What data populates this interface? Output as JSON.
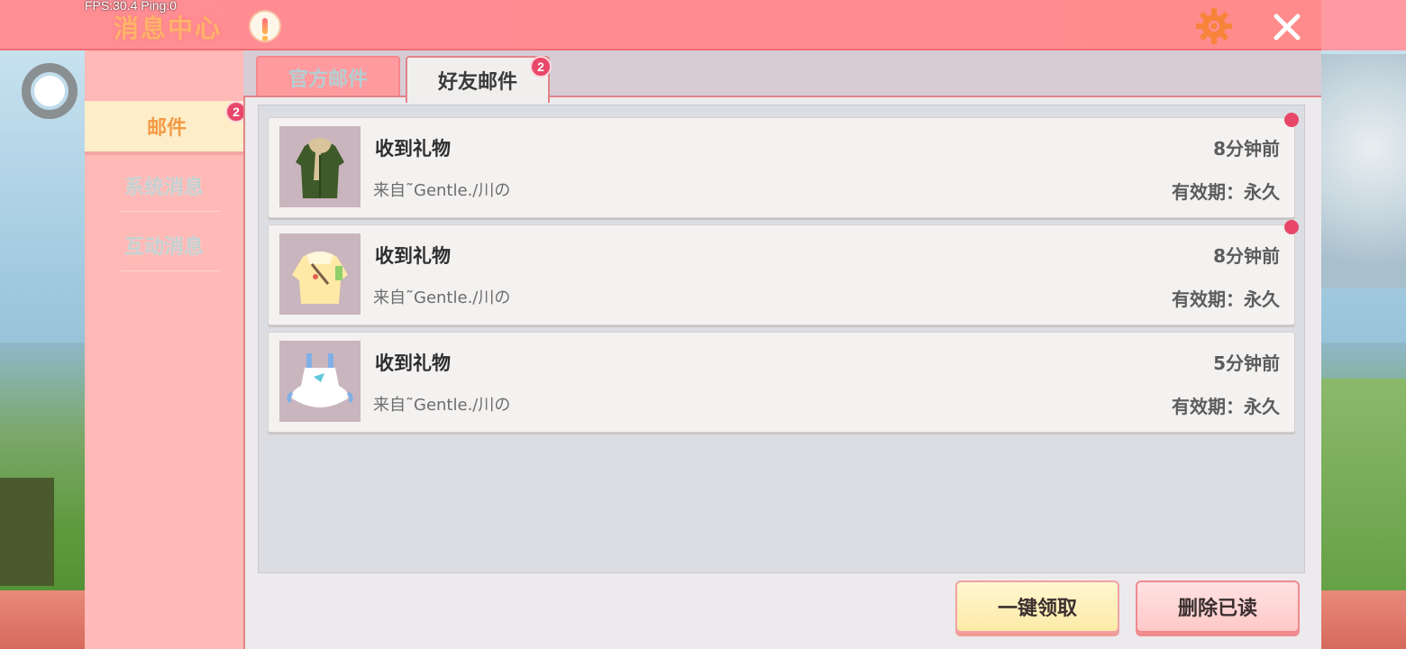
{
  "header": {
    "fps_text": "FPS:30.4  Ping:0",
    "title": "消息中心",
    "alert_icon": "exclamation-icon",
    "settings_icon": "gear-icon",
    "close_icon": "close-icon"
  },
  "sidebar": {
    "items": [
      {
        "label": "邮件",
        "active": true,
        "badge": "2"
      },
      {
        "label": "系统消息",
        "active": false
      },
      {
        "label": "互动消息",
        "active": false
      }
    ]
  },
  "tabs": [
    {
      "label": "官方邮件",
      "active": false
    },
    {
      "label": "好友邮件",
      "active": true,
      "badge": "2"
    }
  ],
  "mails": [
    {
      "subject": "收到礼物",
      "sender": "来自˜Gentle./川の",
      "time": "8分钟前",
      "expiry": "有效期：永久",
      "unread": true,
      "item_icon": "green-coat-icon"
    },
    {
      "subject": "收到礼物",
      "sender": "来自˜Gentle./川の",
      "time": "8分钟前",
      "expiry": "有效期：永久",
      "unread": true,
      "item_icon": "yellow-jacket-icon"
    },
    {
      "subject": "收到礼物",
      "sender": "来自˜Gentle./川の",
      "time": "5分钟前",
      "expiry": "有效期：永久",
      "unread": false,
      "item_icon": "white-dress-icon"
    }
  ],
  "actions": {
    "claim_all": "一键领取",
    "delete_read": "删除已读"
  },
  "colors": {
    "accent": "#ff8d95",
    "badge": "#e8476a",
    "active_tab_text": "#f39a45"
  }
}
